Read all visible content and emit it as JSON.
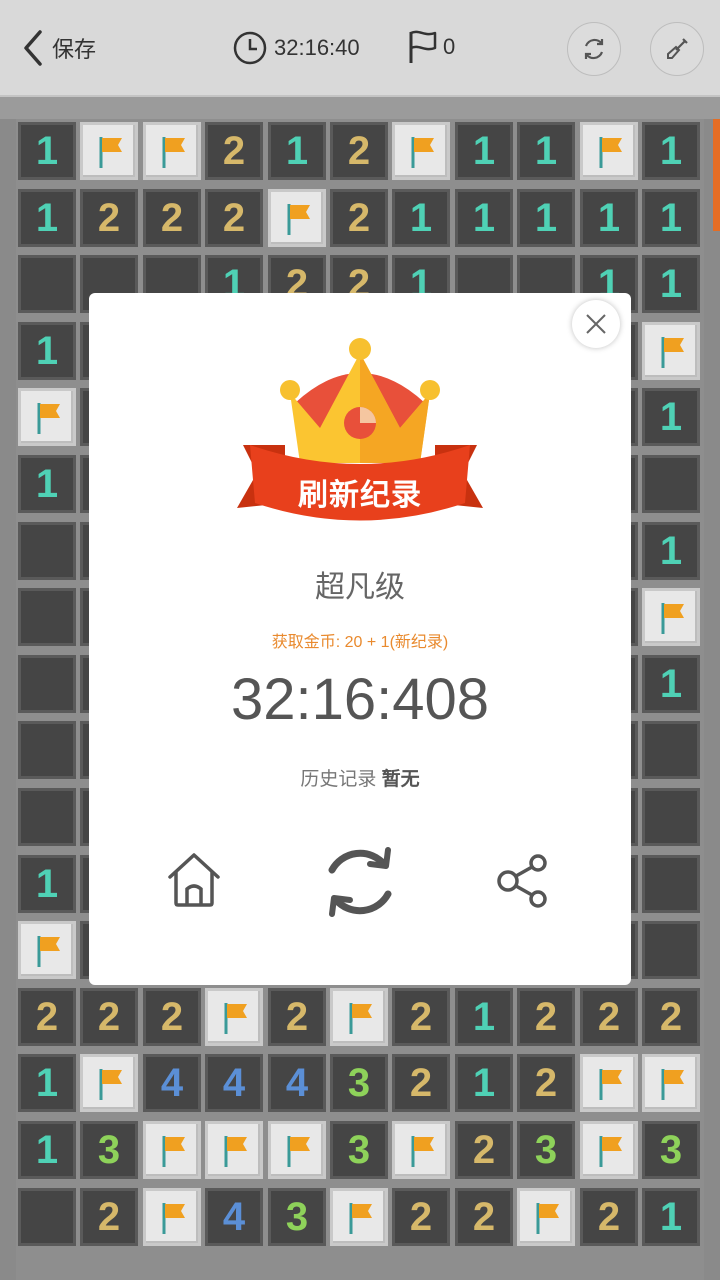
{
  "topbar": {
    "back_label": "保存",
    "timer": "32:16:40",
    "flag_count": "0"
  },
  "board": {
    "rows": [
      [
        "1",
        "F",
        "F",
        "2",
        "1",
        "2",
        "F",
        "1",
        "1",
        "F",
        "1"
      ],
      [
        "1",
        "2",
        "2",
        "2",
        "F",
        "2",
        "1",
        "1",
        "1",
        "1",
        "1"
      ],
      [
        "",
        "",
        "",
        "1",
        "2",
        "2",
        "1",
        "",
        "",
        "1",
        "1"
      ],
      [
        "1",
        "",
        "",
        "",
        "",
        "",
        "",
        "",
        "",
        "",
        "F"
      ],
      [
        "F",
        "",
        "",
        "",
        "",
        "",
        "",
        "",
        "",
        "",
        "1"
      ],
      [
        "1",
        "",
        "",
        "",
        "",
        "",
        "",
        "",
        "",
        "",
        ""
      ],
      [
        "",
        "",
        "",
        "",
        "",
        "",
        "",
        "",
        "",
        "",
        "1"
      ],
      [
        "",
        "",
        "",
        "",
        "",
        "",
        "",
        "",
        "",
        "",
        "F"
      ],
      [
        "",
        "",
        "",
        "",
        "",
        "",
        "",
        "",
        "",
        "",
        "1"
      ],
      [
        "",
        "",
        "",
        "",
        "",
        "",
        "",
        "",
        "",
        "",
        ""
      ],
      [
        "",
        "",
        "",
        "",
        "",
        "",
        "",
        "",
        "",
        "",
        ""
      ],
      [
        "1",
        "",
        "",
        "",
        "",
        "",
        "",
        "",
        "",
        "",
        ""
      ],
      [
        "F",
        "",
        "",
        "",
        "",
        "",
        "",
        "",
        "",
        "",
        ""
      ],
      [
        "2",
        "2",
        "2",
        "F",
        "2",
        "F",
        "2",
        "1",
        "2",
        "2",
        "2"
      ],
      [
        "1",
        "F",
        "4",
        "4",
        "4",
        "3",
        "2",
        "1",
        "2",
        "F",
        "F"
      ],
      [
        "1",
        "3",
        "F",
        "F",
        "F",
        "3",
        "F",
        "2",
        "3",
        "F",
        "3"
      ],
      [
        "",
        "2",
        "F",
        "4",
        "3",
        "F",
        "2",
        "2",
        "F",
        "2",
        "1"
      ]
    ]
  },
  "dialog": {
    "badge": "刷新纪录",
    "level": "超凡级",
    "coins": "获取金币: 20 + 1(新纪录)",
    "time": "32:16:408",
    "history_label": "历史记录",
    "history_value": "暂无"
  },
  "colors": {
    "accent": "#e46d24",
    "ribbon": "#e8401c",
    "crown": "#f7b733"
  }
}
